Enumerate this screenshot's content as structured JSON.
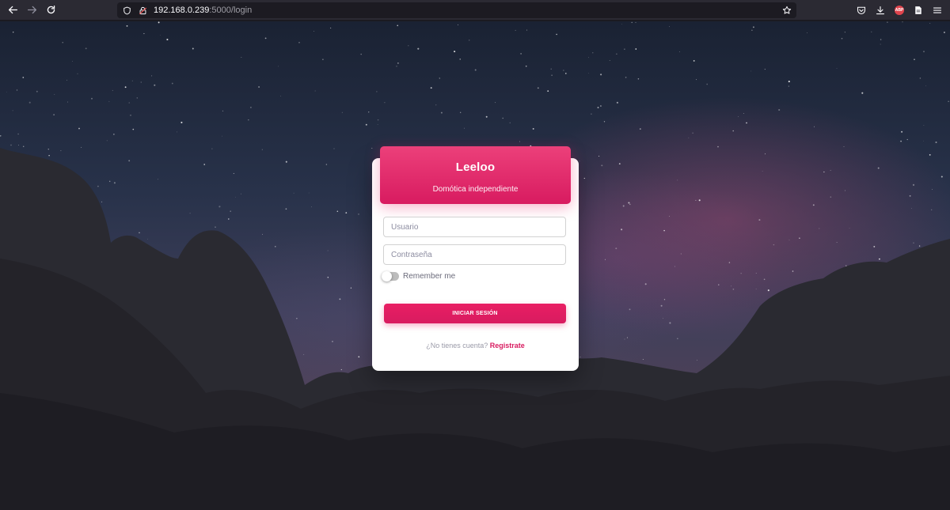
{
  "browser": {
    "url_host": "192.168.0.239",
    "url_path": ":5000/login",
    "icons": [
      "back-icon",
      "forward-icon",
      "reload-icon",
      "shield-icon",
      "lock-insecure-icon",
      "bookmark-star-icon",
      "pocket-icon",
      "download-icon",
      "adblock-icon",
      "reader-icon",
      "menu-icon"
    ],
    "adblock_label": "ABP"
  },
  "login": {
    "title": "Leeloo",
    "subtitle": "Domótica independiente",
    "username_placeholder": "Usuario",
    "password_placeholder": "Contraseña",
    "remember_label": "Remember me",
    "remember_checked": false,
    "submit_label": "INICIAR SESIÓN",
    "signup_question": "¿No tienes cuenta?",
    "signup_link": "Registrate"
  },
  "colors": {
    "accent": "#e91e63",
    "accent_dark": "#d81b60",
    "toolbar": "#2b2a33"
  }
}
